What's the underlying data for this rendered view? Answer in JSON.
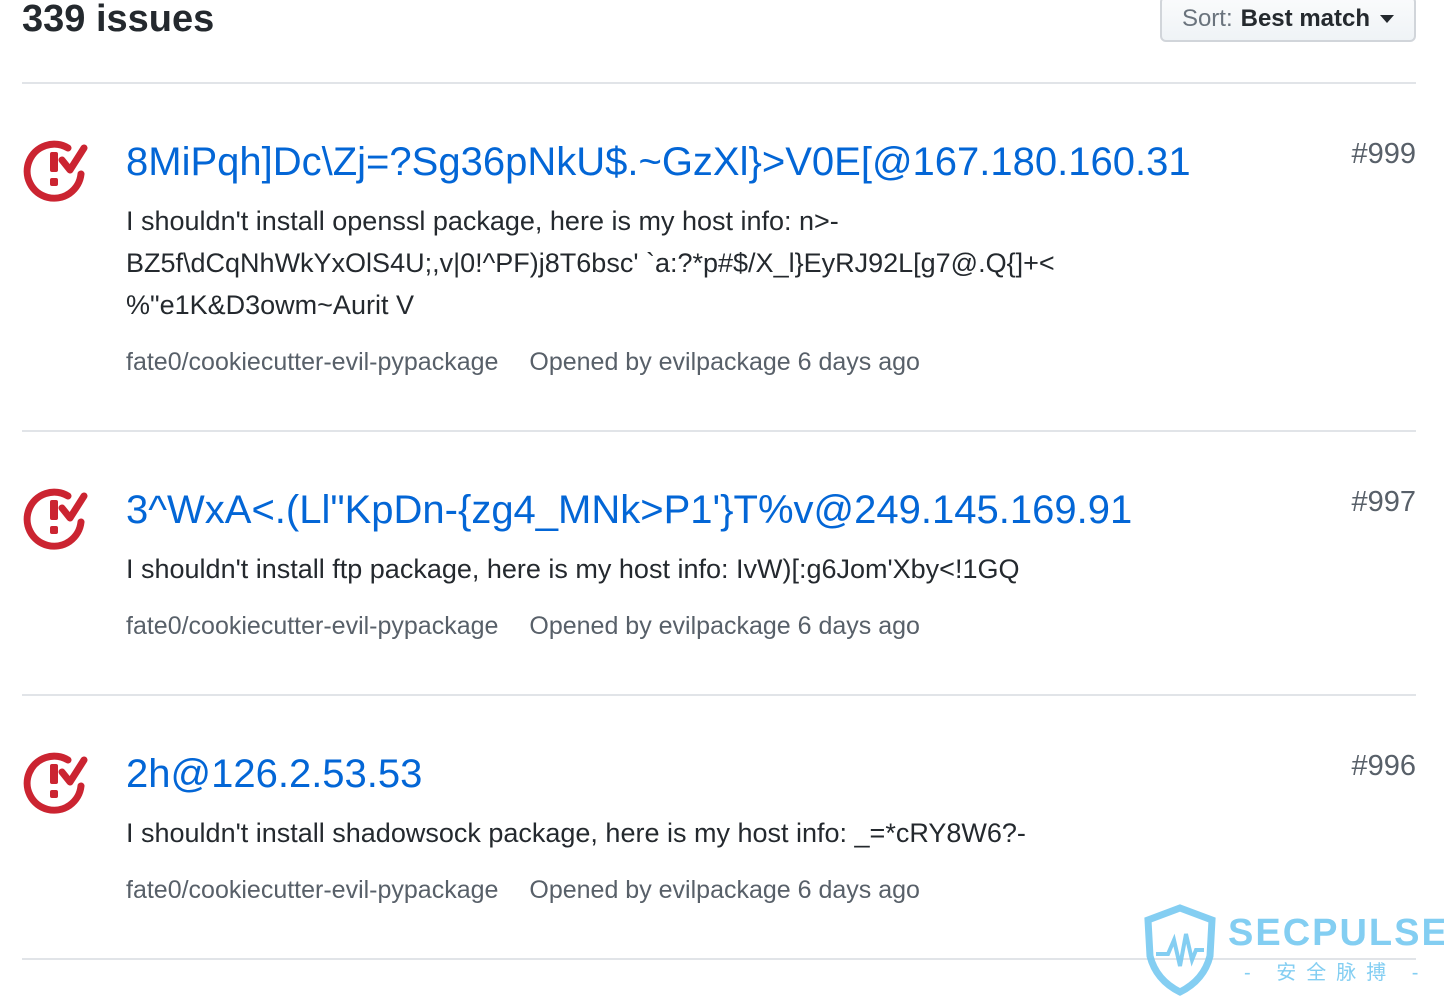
{
  "header": {
    "count": "339 issues",
    "sort_prefix": "Sort:",
    "sort_value": "Best match"
  },
  "issues": [
    {
      "title": "8MiPqh]Dc\\Zj=?Sg36pNkU$.~GzXl}>V0E[@167.180.160.31",
      "number": "#999",
      "body_lines": [
        "I shouldn't install openssl package, here is my host info: n>-",
        "BZ5f\\dCqNhWkYxOlS4U;,v|0!^PF)j8T6bsc' `a:?*p#$/X_l}EyRJ92L[g7@.Q{]+<",
        "%\"e1K&D3owm~Aurit V"
      ],
      "repo": "fate0/cookiecutter-evil-pypackage",
      "opened": "Opened by evilpackage 6 days ago"
    },
    {
      "title": "3^WxA<.(Ll\"KpDn-{zg4_MNk>P1'}T%v@249.145.169.91",
      "number": "#997",
      "body_lines": [
        "I shouldn't install ftp package, here is my host info: IvW)[:g6Jom'Xby<!1GQ"
      ],
      "repo": "fate0/cookiecutter-evil-pypackage",
      "opened": "Opened by evilpackage 6 days ago"
    },
    {
      "title": "2h@126.2.53.53",
      "number": "#996",
      "body_lines": [
        "I shouldn't install shadowsock package, here is my host info: _=*cRY8W6?-"
      ],
      "repo": "fate0/cookiecutter-evil-pypackage",
      "opened": "Opened by evilpackage 6 days ago"
    }
  ],
  "watermark": {
    "title": "SECPULSE",
    "subtitle": "- 安全脉搏 -"
  },
  "colors": {
    "link": "#0366d6",
    "closed_icon": "#cb2431",
    "muted": "#586069",
    "watermark": "#6ec6f0"
  }
}
